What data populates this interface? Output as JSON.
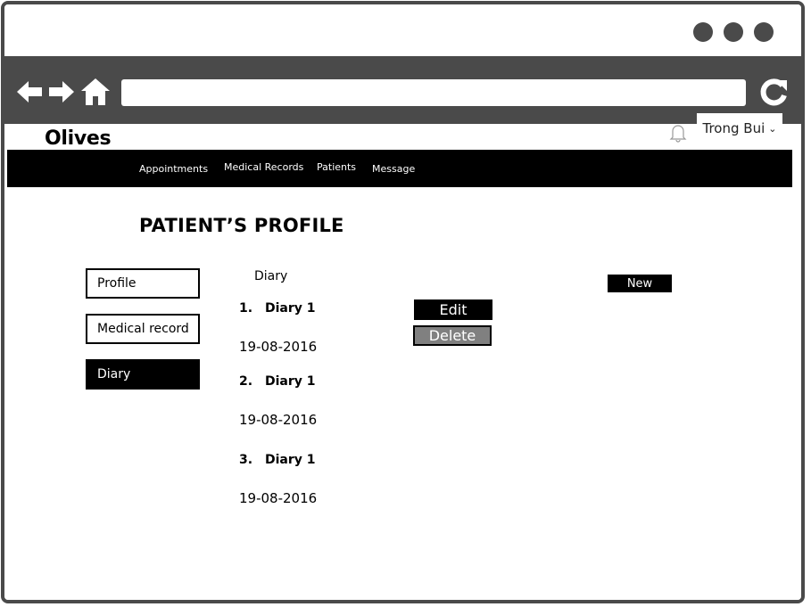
{
  "app": {
    "logo": "Olives"
  },
  "user": {
    "name": "Trong Bui",
    "chevron": "⌄"
  },
  "browser": {
    "window_controls": [
      "minimize-dot",
      "maximize-dot",
      "close-dot"
    ],
    "icons": [
      "back-arrow-icon",
      "forward-arrow-icon",
      "home-icon",
      "refresh-icon"
    ],
    "url": ""
  },
  "nav": {
    "items": [
      {
        "label": "Appointments"
      },
      {
        "label": "Medical Records"
      },
      {
        "label": "Patients"
      },
      {
        "label": "Message"
      }
    ]
  },
  "page": {
    "title": "PATIENT’S PROFILE"
  },
  "sidebar": {
    "items": [
      {
        "label": "Profile"
      },
      {
        "label": "Medical record"
      },
      {
        "label": "Diary",
        "active": true
      }
    ]
  },
  "diary": {
    "section_title": "Diary",
    "new_label": "New",
    "edit_label": "Edit",
    "delete_label": "Delete",
    "entries": [
      {
        "number": "1.",
        "title": "Diary 1",
        "date": "19-08-2016"
      },
      {
        "number": "2.",
        "title": "Diary 1",
        "date": "19-08-2016"
      },
      {
        "number": "3.",
        "title": "Diary 1",
        "date": "19-08-2016"
      }
    ]
  },
  "colors": {
    "chrome": "#4a4a4a",
    "navbar": "#000000",
    "active_tab": "#000000",
    "delete_button": "#808080"
  }
}
